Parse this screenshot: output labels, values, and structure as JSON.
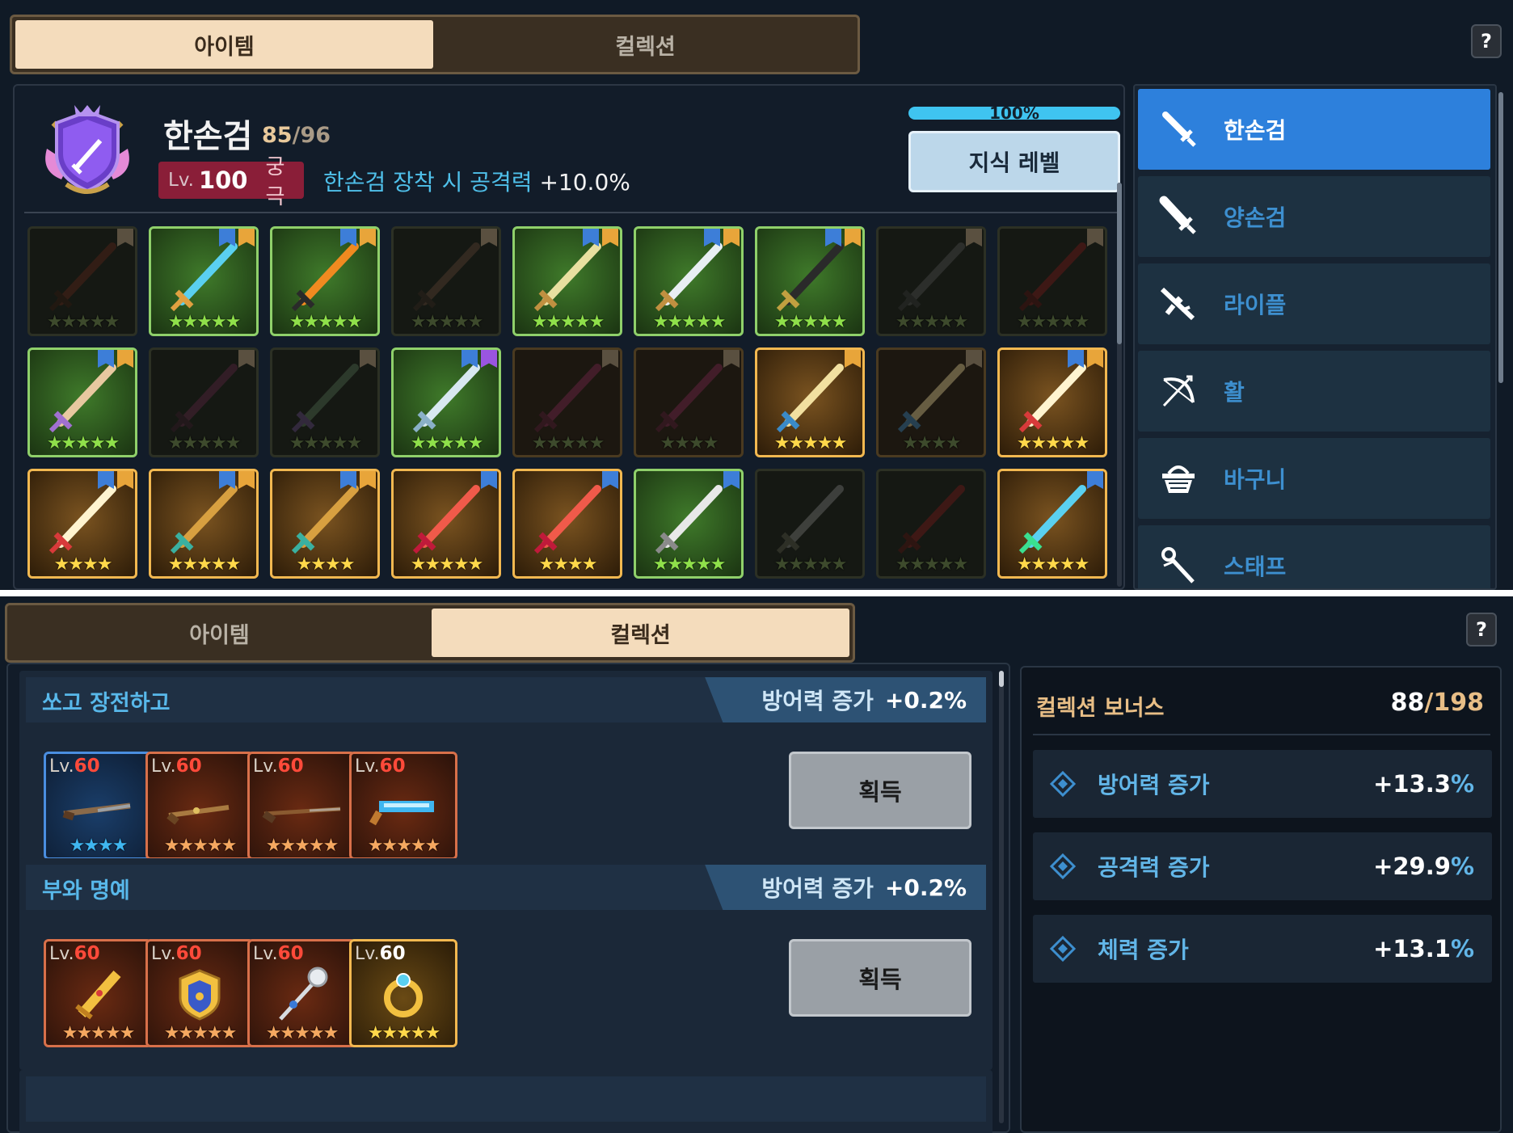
{
  "top": {
    "tabs": [
      {
        "label": "아이템",
        "active": true
      },
      {
        "label": "컬렉션",
        "active": false
      }
    ],
    "help_label": "?",
    "category": {
      "name": "한손검",
      "owned": "85",
      "total": "96",
      "level_prefix": "Lv.",
      "level": "100",
      "rank": "궁극",
      "bonus_label": "한손검 장착 시 공격력",
      "bonus_value": "+10.0%"
    },
    "progress_text": "100%",
    "progress_fraction": 1.0,
    "knowledge_button": "지식 레벨",
    "grid_rows": [
      [
        {
          "rarity": "dim",
          "badges": [
            "grey"
          ],
          "stars": "★★★★★",
          "icon": "dark-sword-icon"
        },
        {
          "rarity": "green",
          "badges": [
            "book",
            "medal"
          ],
          "stars": "★★★★★",
          "icon": "ice-sword-icon"
        },
        {
          "rarity": "green",
          "badges": [
            "book",
            "medal"
          ],
          "stars": "★★★★★",
          "icon": "flame-sword-icon"
        },
        {
          "rarity": "dim",
          "badges": [
            "grey"
          ],
          "stars": "★★★★★",
          "icon": "cleaver-icon"
        },
        {
          "rarity": "green",
          "badges": [
            "book",
            "medal"
          ],
          "stars": "★★★★★",
          "icon": "golden-longsword-icon"
        },
        {
          "rarity": "green",
          "badges": [
            "book",
            "medal"
          ],
          "stars": "★★★★★",
          "icon": "rapier-icon"
        },
        {
          "rarity": "green",
          "badges": [
            "book",
            "medal"
          ],
          "stars": "★★★★★",
          "icon": "katana-icon"
        },
        {
          "rarity": "dim",
          "badges": [
            "grey"
          ],
          "stars": "★★★★★",
          "icon": "thorn-rapier-icon"
        },
        {
          "rarity": "dim",
          "badges": [
            "grey"
          ],
          "stars": "★★★★★",
          "icon": "crimson-blade-icon"
        }
      ],
      [
        {
          "rarity": "green",
          "badges": [
            "book",
            "medal"
          ],
          "stars": "★★★★★",
          "icon": "wooden-sword-icon"
        },
        {
          "rarity": "dim",
          "badges": [
            "grey"
          ],
          "stars": "★★★★★",
          "icon": "axe-blade-icon"
        },
        {
          "rarity": "dim",
          "badges": [
            "grey"
          ],
          "stars": "★★★★★",
          "icon": "vine-sword-icon"
        },
        {
          "rarity": "green",
          "badges": [
            "book",
            "purple"
          ],
          "stars": "★★★★★",
          "icon": "crystal-sword-icon"
        },
        {
          "rarity": "dimgold",
          "badges": [
            "grey"
          ],
          "stars": "★★★★★",
          "icon": "rose-blade-icon"
        },
        {
          "rarity": "dimgold",
          "badges": [
            "grey"
          ],
          "stars": "★★★★",
          "icon": "rose-blade-icon"
        },
        {
          "rarity": "gold",
          "badges": [
            "medal"
          ],
          "stars": "★★★★★",
          "icon": "holy-sword-icon"
        },
        {
          "rarity": "dimgold",
          "badges": [
            "grey"
          ],
          "stars": "★★★★",
          "icon": "holy-sword-icon"
        },
        {
          "rarity": "gold",
          "badges": [
            "book",
            "medal"
          ],
          "stars": "★★★★★",
          "icon": "great-sword-icon"
        }
      ],
      [
        {
          "rarity": "gold",
          "badges": [
            "book",
            "medal"
          ],
          "stars": "★★★★",
          "icon": "great-sword-icon"
        },
        {
          "rarity": "gold",
          "badges": [
            "book",
            "medal"
          ],
          "stars": "★★★★★",
          "icon": "jade-rapier-icon"
        },
        {
          "rarity": "gold",
          "badges": [
            "book",
            "medal"
          ],
          "stars": "★★★★",
          "icon": "jade-rapier-icon"
        },
        {
          "rarity": "gold",
          "badges": [
            "book"
          ],
          "stars": "★★★★★",
          "icon": "ruby-blade-icon"
        },
        {
          "rarity": "gold",
          "badges": [
            "book"
          ],
          "stars": "★★★★",
          "icon": "ruby-blade-icon"
        },
        {
          "rarity": "green",
          "badges": [
            "book"
          ],
          "stars": "★★★★★",
          "icon": "drill-lance-icon"
        },
        {
          "rarity": "dim",
          "badges": [],
          "stars": "★★★★★",
          "icon": "short-sword-icon"
        },
        {
          "rarity": "dim",
          "badges": [],
          "stars": "★★★★★",
          "icon": "red-dagger-icon"
        },
        {
          "rarity": "gold",
          "badges": [
            "book"
          ],
          "stars": "★★★★★",
          "icon": "prism-sword-icon"
        }
      ]
    ],
    "sidebar": [
      {
        "label": "한손검",
        "icon": "one-hand-sword-icon",
        "active": true
      },
      {
        "label": "양손검",
        "icon": "two-hand-sword-icon",
        "active": false
      },
      {
        "label": "라이플",
        "icon": "rifle-icon",
        "active": false
      },
      {
        "label": "활",
        "icon": "bow-icon",
        "active": false
      },
      {
        "label": "바구니",
        "icon": "basket-icon",
        "active": false
      },
      {
        "label": "스태프",
        "icon": "staff-icon",
        "active": false
      }
    ]
  },
  "bottom": {
    "tabs": [
      {
        "label": "아이템",
        "active": false
      },
      {
        "label": "컬렉션",
        "active": true
      }
    ],
    "help_label": "?",
    "sets": [
      {
        "title": "쏘고 장전하고",
        "bonus_label": "방어력 증가",
        "bonus_value": "+0.2%",
        "button": "획득",
        "items": [
          {
            "lv_prefix": "Lv.",
            "lv": "60",
            "style": "blue",
            "stars": "★★★★",
            "icon": "musket-icon"
          },
          {
            "lv_prefix": "Lv.",
            "lv": "60",
            "style": "orange",
            "stars": "★★★★★",
            "icon": "flintlock-icon"
          },
          {
            "lv_prefix": "Lv.",
            "lv": "60",
            "style": "orange",
            "stars": "★★★★★",
            "icon": "long-rifle-icon"
          },
          {
            "lv_prefix": "Lv.",
            "lv": "60",
            "style": "orange",
            "stars": "★★★★★",
            "icon": "blaster-icon"
          }
        ]
      },
      {
        "title": "부와 명예",
        "bonus_label": "방어력 증가",
        "bonus_value": "+0.2%",
        "button": "획득",
        "items": [
          {
            "lv_prefix": "Lv.",
            "lv": "60",
            "style": "orange",
            "stars": "★★★★★",
            "icon": "golden-sword-icon"
          },
          {
            "lv_prefix": "Lv.",
            "lv": "60",
            "style": "orange",
            "stars": "★★★★★",
            "icon": "crest-shield-icon"
          },
          {
            "lv_prefix": "Lv.",
            "lv": "60",
            "style": "orange",
            "stars": "★★★★★",
            "icon": "mace-icon"
          },
          {
            "lv_prefix": "Lv.",
            "lv": "60",
            "style": "gold",
            "stars": "★★★★★",
            "icon": "ring-icon"
          }
        ]
      }
    ],
    "collection_bonus": {
      "title": "컬렉션 보너스",
      "owned": "88",
      "total": "198",
      "stats": [
        {
          "name": "방어력 증가",
          "value": "+13.3",
          "unit": "%"
        },
        {
          "name": "공격력 증가",
          "value": "+29.9",
          "unit": "%"
        },
        {
          "name": "체력 증가",
          "value": "+13.1",
          "unit": "%"
        }
      ]
    }
  },
  "colors": {
    "accent_blue": "#2d80dc",
    "tab_active": "#f4dcbc",
    "progress": "#3fc4f0",
    "level_badge": "#8a1e38",
    "highlight_text": "#4fc0ea",
    "gold_text": "#e8be86"
  }
}
